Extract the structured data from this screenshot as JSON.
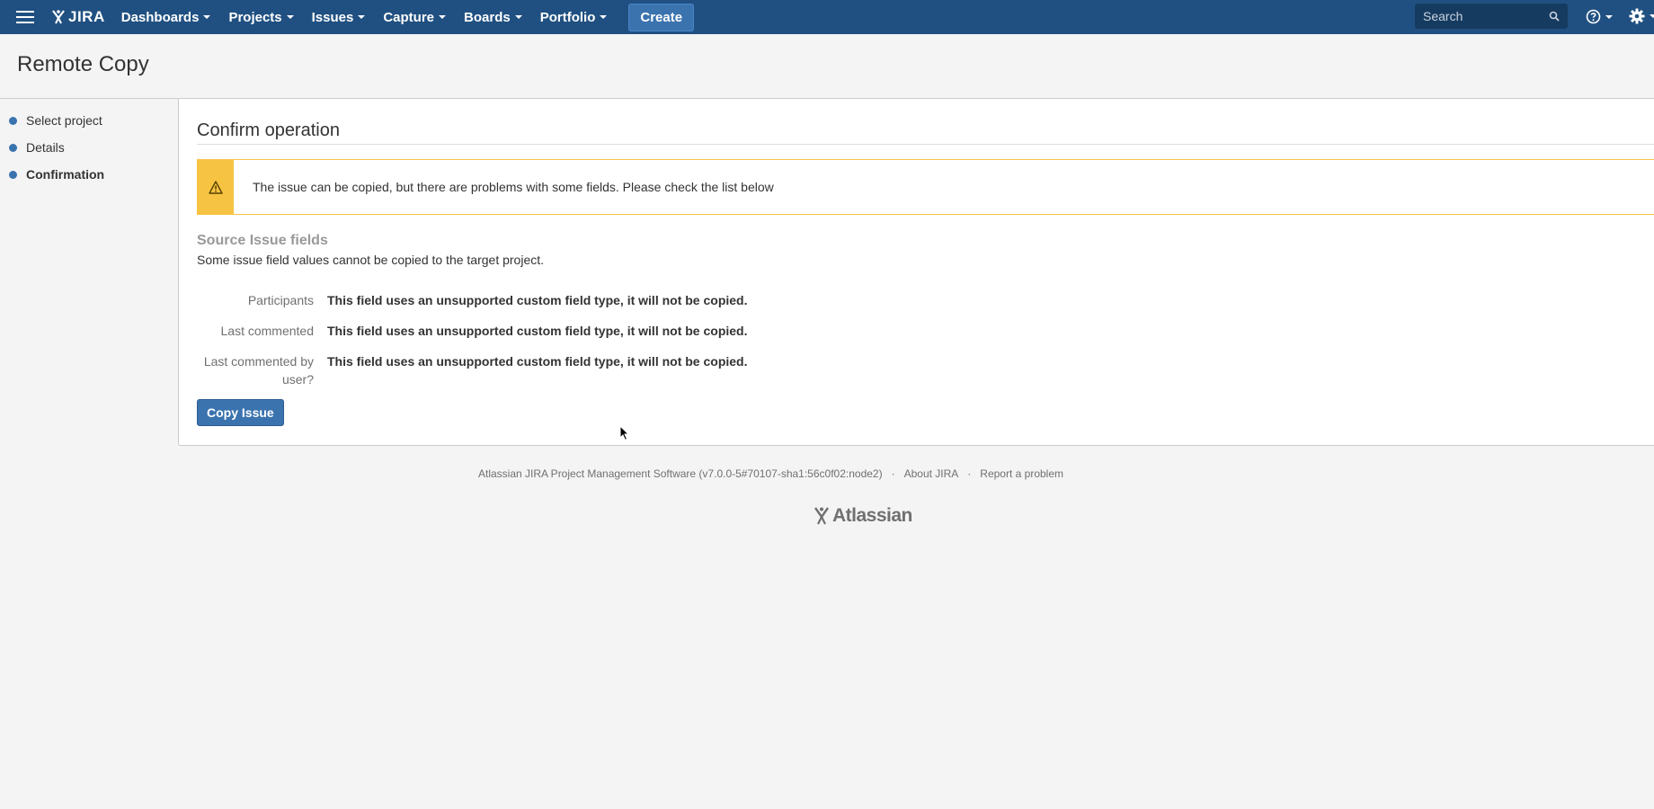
{
  "topbar": {
    "logo_text": "JIRA",
    "nav": [
      {
        "label": "Dashboards"
      },
      {
        "label": "Projects"
      },
      {
        "label": "Issues"
      },
      {
        "label": "Capture"
      },
      {
        "label": "Boards"
      },
      {
        "label": "Portfolio"
      }
    ],
    "create_label": "Create",
    "search_placeholder": "Search",
    "brand_color": "#205081"
  },
  "page": {
    "title": "Remote Copy"
  },
  "sidebar": {
    "steps": [
      {
        "label": "Select project"
      },
      {
        "label": "Details"
      },
      {
        "label": "Confirmation",
        "active": true
      }
    ]
  },
  "main": {
    "heading": "Confirm operation",
    "warning_text": "The issue can be copied, but there are problems with some fields. Please check the list below",
    "fields_title": "Source Issue fields",
    "fields_description": "Some issue field values cannot be copied to the target project.",
    "fields": [
      {
        "label": "Participants",
        "message": "This field uses an unsupported custom field type, it will not be copied."
      },
      {
        "label": "Last commented",
        "message": "This field uses an unsupported custom field type, it will not be copied."
      },
      {
        "label": "Last commented by user?",
        "message": "This field uses an unsupported custom field type, it will not be copied."
      }
    ],
    "copy_button_label": "Copy Issue"
  },
  "footer": {
    "version_text": "Atlassian JIRA Project Management Software (v7.0.0-5#70107-sha1:56c0f02:node2)",
    "separator": "·",
    "about_label": "About JIRA",
    "report_label": "Report a problem",
    "logo_text": "Atlassian"
  }
}
